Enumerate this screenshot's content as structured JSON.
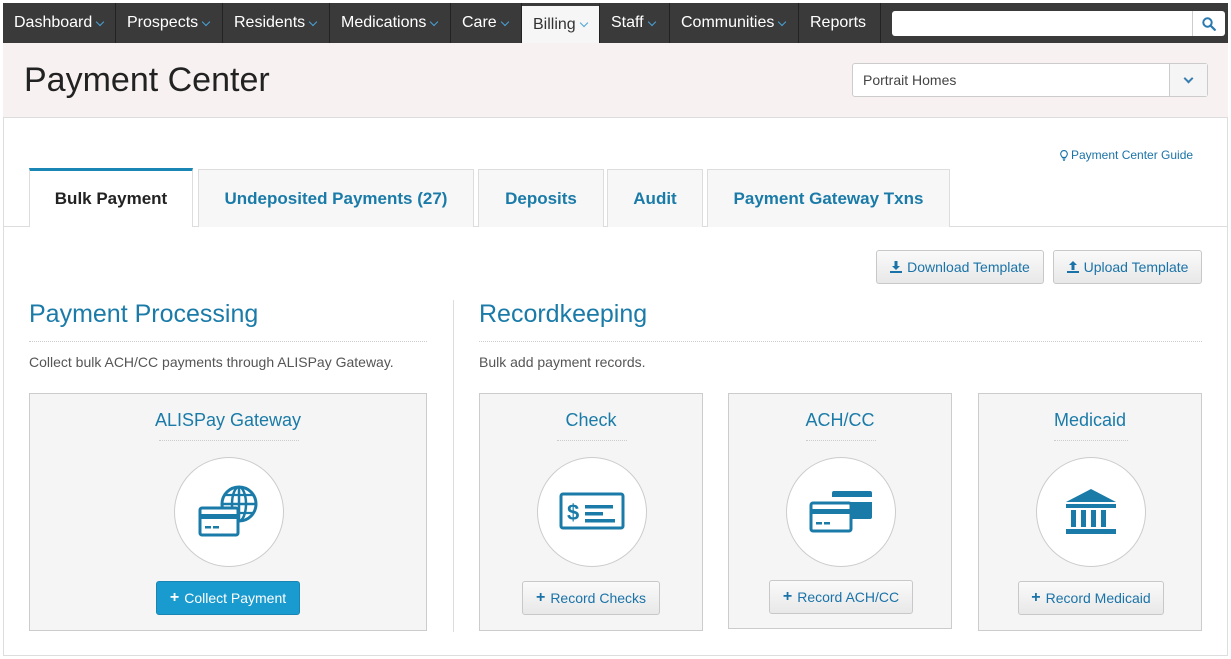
{
  "nav": {
    "items": [
      {
        "label": "Dashboard"
      },
      {
        "label": "Prospects"
      },
      {
        "label": "Residents"
      },
      {
        "label": "Medications"
      },
      {
        "label": "Care"
      },
      {
        "label": "Billing"
      },
      {
        "label": "Staff"
      },
      {
        "label": "Communities"
      },
      {
        "label": "Reports"
      }
    ],
    "active": "Billing",
    "search_value": ""
  },
  "header": {
    "title": "Payment Center",
    "community": "Portrait Homes"
  },
  "guide_link": "Payment Center Guide",
  "tabs": [
    {
      "label": "Bulk Payment"
    },
    {
      "label": "Undeposited Payments (27)"
    },
    {
      "label": "Deposits"
    },
    {
      "label": "Audit"
    },
    {
      "label": "Payment Gateway Txns"
    }
  ],
  "toolbar": {
    "download_label": "Download Template",
    "upload_label": "Upload Template"
  },
  "processing": {
    "title": "Payment Processing",
    "description": "Collect bulk ACH/CC payments through ALISPay Gateway.",
    "card": {
      "title": "ALISPay Gateway",
      "button": "Collect Payment",
      "icon": "credit-card-globe-icon"
    }
  },
  "recordkeeping": {
    "title": "Recordkeeping",
    "description": "Bulk add payment records.",
    "cards": [
      {
        "title": "Check",
        "button": "Record Checks",
        "icon": "check-icon"
      },
      {
        "title": "ACH/CC",
        "button": "Record ACH/CC",
        "icon": "credit-cards-icon"
      },
      {
        "title": "Medicaid",
        "button": "Record Medicaid",
        "icon": "bank-icon"
      }
    ]
  },
  "colors": {
    "accent": "#1a7ba8",
    "primary_button": "#1a9bd0",
    "nav_bg": "#3a3a3a",
    "header_bg": "#f7f2f1"
  }
}
